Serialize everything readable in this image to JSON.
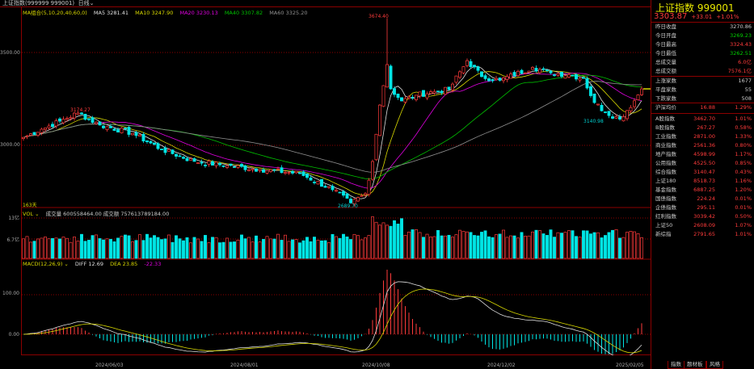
{
  "header": {
    "title": "上证指数(999999 999001)",
    "period": "日线"
  },
  "ma_legend": {
    "label": "MA组合(5,10,20,40,60,0)",
    "ma5": "MA5 3281.41",
    "ma10": "MA10 3247.90",
    "ma20": "MA20 3230.13",
    "ma40": "MA40 3307.82",
    "ma60": "MA60 3325.20"
  },
  "price_axis": {
    "label_hi": "3500.00",
    "label_lo": "3000.00"
  },
  "annotations": {
    "high": "3674.40",
    "low": "2689.70",
    "peak1": "3174.27",
    "low2": "3140.98",
    "count": "163天"
  },
  "volume": {
    "legend_name": "VOL",
    "legend": "成交量 600558464.00  成交额 757613789184.00",
    "axis_hi": "13亿",
    "axis_mid": "6.7亿"
  },
  "macd": {
    "legend_name": "MACD(12,26,9)",
    "diff": "DIFF 12.69",
    "dea": "DEA 23.85",
    "macd": "-22.33",
    "axis_hi": "100.00",
    "axis_zero": "0.00"
  },
  "dates": [
    "2024/06/03",
    "2024/08/01",
    "2024/10/08",
    "2024/12/02",
    "2025/02/05"
  ],
  "tabs": [
    "指数",
    "题材板",
    "风格"
  ],
  "panel": {
    "title": "上证指数  999001",
    "price": "3303.87",
    "change": "+33.01",
    "pct": "+1.01%",
    "stats": [
      {
        "label": "昨日收盘",
        "value": "3270.86",
        "color": "#ccc"
      },
      {
        "label": "今日开盘",
        "value": "3269.23",
        "color": "#00d000"
      },
      {
        "label": "今日最高",
        "value": "3324.43",
        "color": "#ff3b3b"
      },
      {
        "label": "今日最低",
        "value": "3262.51",
        "color": "#00d000"
      },
      {
        "label": "总成交量",
        "value": "6.0亿",
        "color": "#ff3b3b"
      },
      {
        "label": "总成交额",
        "value": "7576.1亿",
        "color": "#ff3b3b"
      }
    ],
    "breadth": [
      {
        "label": "上涨家数",
        "value": "1677"
      },
      {
        "label": "平盘家数",
        "value": "55"
      },
      {
        "label": "下跌家数",
        "value": "508"
      }
    ],
    "indices": [
      {
        "label": "沪深均价",
        "value": "16.88",
        "pct": "1.29%"
      },
      {
        "label": "A股指数",
        "value": "3462.70",
        "pct": "1.01%"
      },
      {
        "label": "B股指数",
        "value": "267.27",
        "pct": "0.58%"
      },
      {
        "label": "工业指数",
        "value": "2871.00",
        "pct": "1.33%"
      },
      {
        "label": "商业指数",
        "value": "2561.36",
        "pct": "0.80%"
      },
      {
        "label": "地产指数",
        "value": "4598.99",
        "pct": "1.17%"
      },
      {
        "label": "公用指数",
        "value": "4525.50",
        "pct": "0.85%"
      },
      {
        "label": "综合指数",
        "value": "3140.47",
        "pct": "0.43%"
      },
      {
        "label": "上证180",
        "value": "8518.73",
        "pct": "1.16%"
      },
      {
        "label": "基金指数",
        "value": "6887.25",
        "pct": "1.20%"
      },
      {
        "label": "国债指数",
        "value": "224.24",
        "pct": "0.01%"
      },
      {
        "label": "企债指数",
        "value": "295.11",
        "pct": "0.01%"
      },
      {
        "label": "红利指数",
        "value": "3039.42",
        "pct": "0.50%"
      },
      {
        "label": "上证50",
        "value": "2608.09",
        "pct": "1.07%"
      },
      {
        "label": "新综指",
        "value": "2791.65",
        "pct": "1.01%"
      }
    ]
  },
  "colors": {
    "up": "#ff3b3b",
    "down": "#00e5e5",
    "ma5": "#e0e0e0",
    "ma10": "#d8d800",
    "ma20": "#e000e0",
    "ma40": "#00c000",
    "ma60": "#909090",
    "grid": "#8b0000"
  },
  "chart_data": {
    "type": "candlestick",
    "description_of_values": "approximate daily close keypoints [candle index, close]",
    "keypoints": [
      [
        0,
        3043
      ],
      [
        5,
        3087
      ],
      [
        10,
        3130
      ],
      [
        15,
        3174
      ],
      [
        21,
        3109
      ],
      [
        30,
        3065
      ],
      [
        38,
        2978
      ],
      [
        47,
        2913
      ],
      [
        56,
        2891
      ],
      [
        65,
        2870
      ],
      [
        76,
        2848
      ],
      [
        85,
        2761
      ],
      [
        90,
        2690
      ],
      [
        94,
        2740
      ],
      [
        96,
        2913
      ],
      [
        98,
        3217
      ],
      [
        100,
        3435
      ],
      [
        101,
        3304
      ],
      [
        104,
        3239
      ],
      [
        108,
        3270
      ],
      [
        113,
        3290
      ],
      [
        117,
        3300
      ],
      [
        122,
        3456
      ],
      [
        126,
        3370
      ],
      [
        131,
        3350
      ],
      [
        140,
        3420
      ],
      [
        145,
        3390
      ],
      [
        150,
        3380
      ],
      [
        154,
        3360
      ],
      [
        157,
        3230
      ],
      [
        160,
        3180
      ],
      [
        164,
        3141
      ],
      [
        168,
        3240
      ],
      [
        170,
        3304
      ]
    ],
    "ylim": [
      2600,
      3700
    ]
  }
}
